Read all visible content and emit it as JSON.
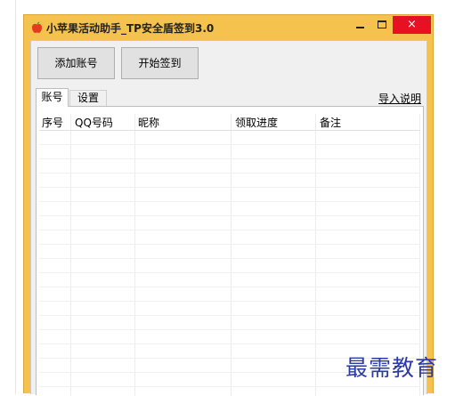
{
  "window": {
    "title": "小苹果活动助手_TP安全盾签到3.0",
    "accent_color": "#f4c24d",
    "close_color": "#e81123",
    "close_glyph": "×"
  },
  "toolbar": {
    "add_account_label": "添加账号",
    "start_sign_label": "开始签到"
  },
  "tabs": {
    "accounts_label": "账号",
    "settings_label": "设置"
  },
  "import_help_label": "导入说明",
  "table": {
    "columns": [
      "序号",
      "QQ号码",
      "昵称",
      "领取进度",
      "备注"
    ],
    "rows": []
  },
  "watermark": "最需教育"
}
